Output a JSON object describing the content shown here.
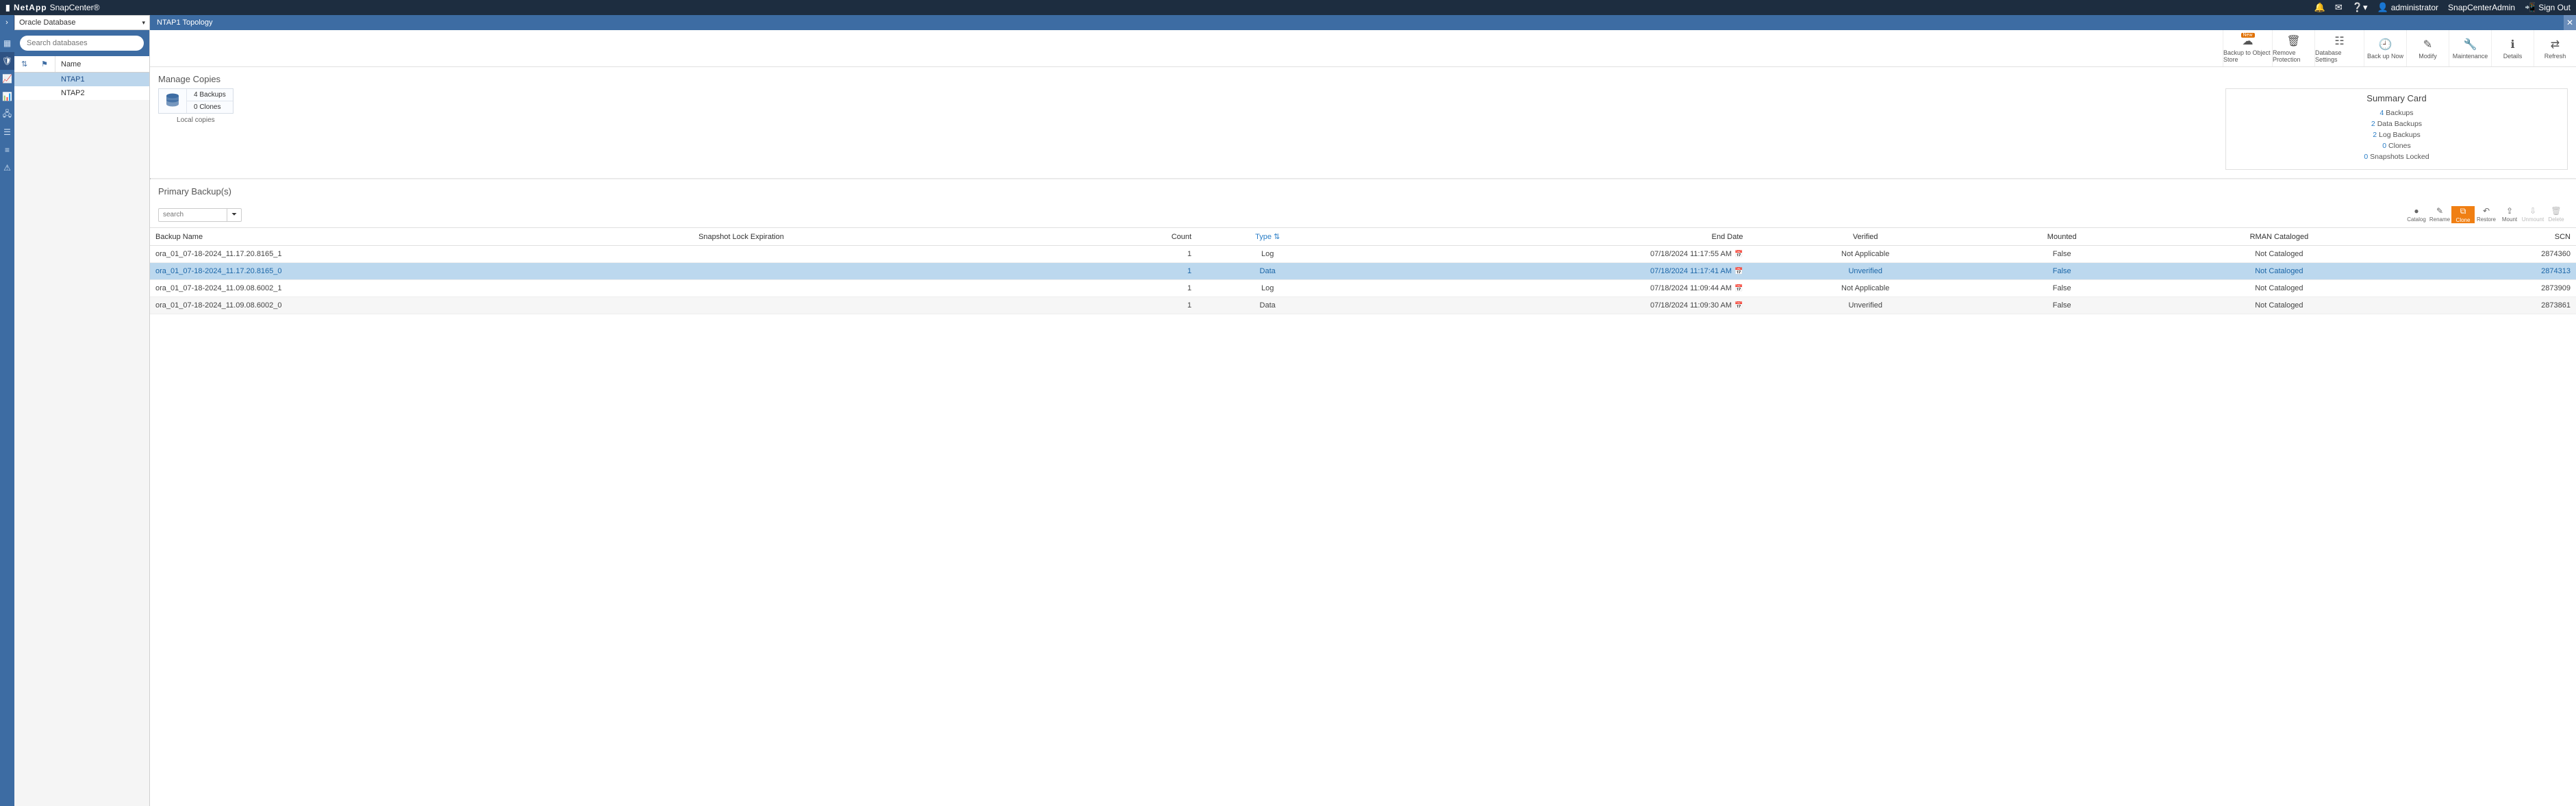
{
  "topbar": {
    "brand_logo": "▮ NetApp",
    "brand_name": "SnapCenter®",
    "help_label": "",
    "user_label": "administrator",
    "role_label": "SnapCenterAdmin",
    "signout_label": "Sign Out"
  },
  "context": {
    "label": "Oracle Database"
  },
  "page_title": "NTAP1 Topology",
  "search_placeholder": "Search databases",
  "db_list_header": "Name",
  "databases": [
    {
      "name": "NTAP1",
      "selected": true
    },
    {
      "name": "NTAP2",
      "selected": false
    }
  ],
  "actions": [
    {
      "key": "backup-object-store",
      "label": "Backup to Object Store",
      "icon": "cloud",
      "badge": "New"
    },
    {
      "key": "remove-protection",
      "label": "Remove Protection",
      "icon": "trash"
    },
    {
      "key": "database-settings",
      "label": "Database Settings",
      "icon": "sliders"
    },
    {
      "key": "backup-now",
      "label": "Back up Now",
      "icon": "clock"
    },
    {
      "key": "modify",
      "label": "Modify",
      "icon": "pencil"
    },
    {
      "key": "maintenance",
      "label": "Maintenance",
      "icon": "wrench"
    },
    {
      "key": "details",
      "label": "Details",
      "icon": "info"
    },
    {
      "key": "refresh",
      "label": "Refresh",
      "icon": "refresh"
    }
  ],
  "manage_copies_title": "Manage Copies",
  "local_copies": {
    "backups": "4 Backups",
    "clones": "0 Clones",
    "label": "Local copies"
  },
  "summary": {
    "title": "Summary Card",
    "rows": [
      {
        "num": "4",
        "text": "Backups"
      },
      {
        "num": "2",
        "text": "Data Backups"
      },
      {
        "num": "2",
        "text": "Log Backups"
      },
      {
        "num": "0",
        "text": "Clones"
      },
      {
        "num": "0",
        "text": "Snapshots Locked"
      }
    ]
  },
  "primary_backups_title": "Primary Backup(s)",
  "pb_search_placeholder": "search",
  "pb_toolbar": [
    {
      "key": "catalog",
      "label": "Catalog",
      "icon": "●",
      "state": ""
    },
    {
      "key": "rename",
      "label": "Rename",
      "icon": "✎",
      "state": ""
    },
    {
      "key": "clone",
      "label": "Clone",
      "icon": "⧉",
      "state": "highlight"
    },
    {
      "key": "restore",
      "label": "Restore",
      "icon": "↶",
      "state": ""
    },
    {
      "key": "mount",
      "label": "Mount",
      "icon": "⇪",
      "state": ""
    },
    {
      "key": "unmount",
      "label": "Unmount",
      "icon": "⇩",
      "state": "disabled"
    },
    {
      "key": "delete",
      "label": "Delete",
      "icon": "🗑",
      "state": "disabled"
    }
  ],
  "columns": {
    "backup_name": "Backup Name",
    "snapshot_lock": "Snapshot Lock Expiration",
    "count": "Count",
    "type": "Type",
    "end_date": "End Date",
    "verified": "Verified",
    "mounted": "Mounted",
    "rman": "RMAN Cataloged",
    "scn": "SCN"
  },
  "rows": [
    {
      "name": "ora_01_07-18-2024_11.17.20.8165_1",
      "lock": "",
      "count": "1",
      "type": "Log",
      "end": "07/18/2024 11:17:55 AM",
      "verified": "Not Applicable",
      "mounted": "False",
      "rman": "Not Cataloged",
      "scn": "2874360",
      "selected": false
    },
    {
      "name": "ora_01_07-18-2024_11.17.20.8165_0",
      "lock": "",
      "count": "1",
      "type": "Data",
      "end": "07/18/2024 11:17:41 AM",
      "verified": "Unverified",
      "mounted": "False",
      "rman": "Not Cataloged",
      "scn": "2874313",
      "selected": true
    },
    {
      "name": "ora_01_07-18-2024_11.09.08.6002_1",
      "lock": "",
      "count": "1",
      "type": "Log",
      "end": "07/18/2024 11:09:44 AM",
      "verified": "Not Applicable",
      "mounted": "False",
      "rman": "Not Cataloged",
      "scn": "2873909",
      "selected": false
    },
    {
      "name": "ora_01_07-18-2024_11.09.08.6002_0",
      "lock": "",
      "count": "1",
      "type": "Data",
      "end": "07/18/2024 11:09:30 AM",
      "verified": "Unverified",
      "mounted": "False",
      "rman": "Not Cataloged",
      "scn": "2873861",
      "selected": false
    }
  ]
}
